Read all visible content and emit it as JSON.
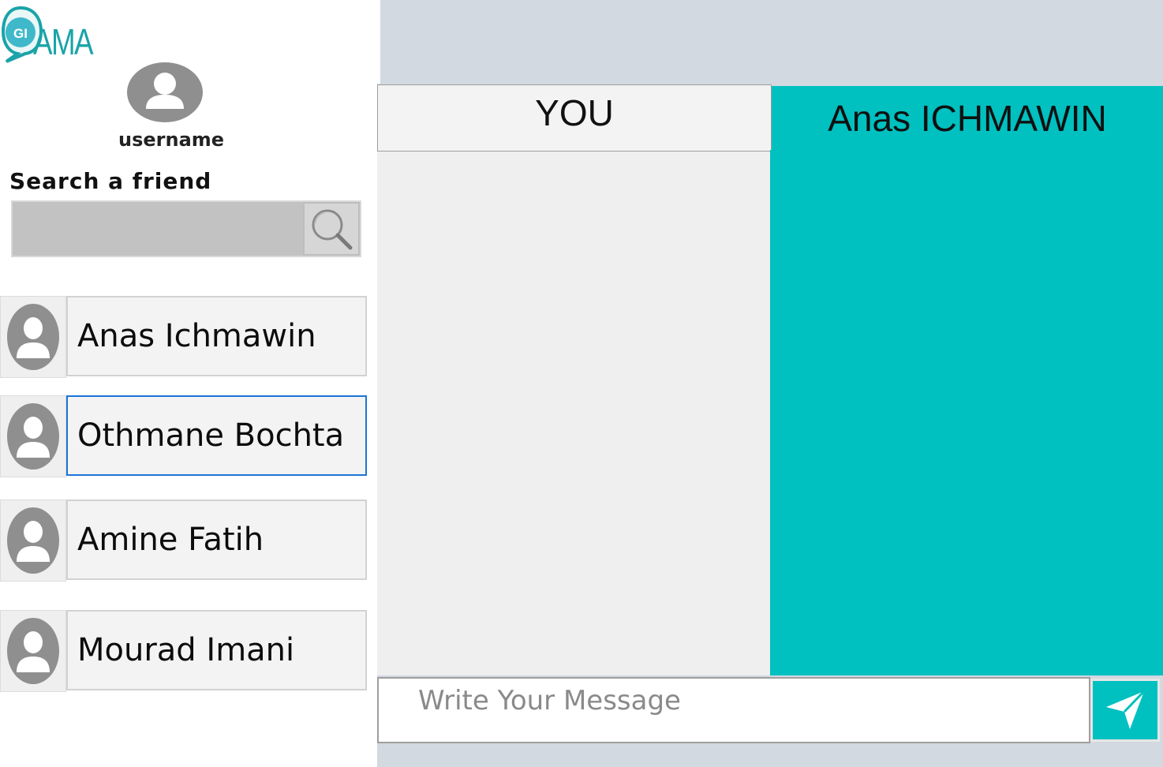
{
  "app": {
    "logo_text": "AMA",
    "logo_badge": "GI",
    "brand_color": "#1aa3a8",
    "accent_color": "#00c0c0"
  },
  "profile": {
    "username": "username",
    "avatar_icon": "user-icon"
  },
  "search": {
    "label": "Search a friend",
    "value": "",
    "button_icon": "search-icon"
  },
  "friends": [
    {
      "name": "Anas Ichmawin",
      "selected": false
    },
    {
      "name": "Othmane Bochta",
      "selected": true
    },
    {
      "name": "Amine Fatih",
      "selected": false
    },
    {
      "name": "Mourad Imani",
      "selected": false
    }
  ],
  "chat": {
    "you_label": "YOU",
    "friend_label": "Anas ICHMAWIN",
    "message_placeholder": "Write Your Message",
    "message_value": "",
    "send_icon": "send-icon"
  }
}
